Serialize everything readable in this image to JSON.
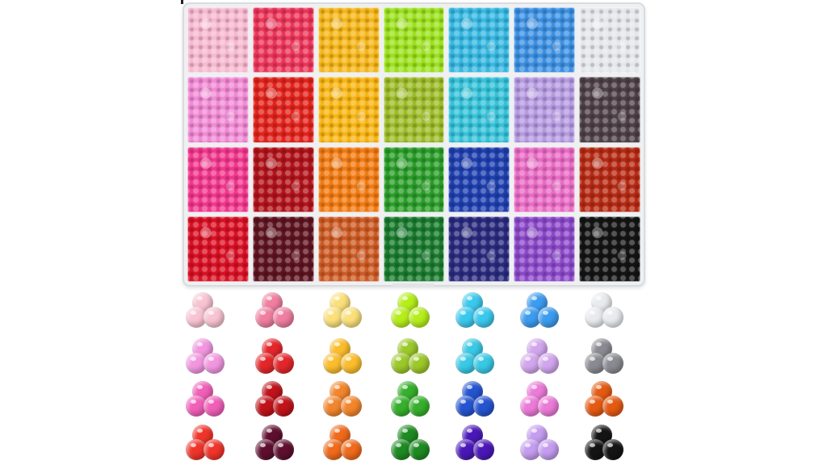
{
  "palette": [
    [
      "#f6b9cf",
      "#ea3558",
      "#f4b51a",
      "#9be01e",
      "#37b7e0",
      "#3c8fe0",
      "#e5e6ea"
    ],
    [
      "#f08ad4",
      "#e0231c",
      "#f7b414",
      "#9cbb2a",
      "#36c1d8",
      "#b59ae0",
      "#4e4047"
    ],
    [
      "#f0378c",
      "#b0131a",
      "#f07a12",
      "#2b9c2a",
      "#1f3fae",
      "#e86bc4",
      "#b52a14"
    ],
    [
      "#d81024",
      "#5e1420",
      "#cc5a24",
      "#1a7a2e",
      "#2a2a7e",
      "#8a48c8",
      "#141414"
    ]
  ],
  "swatches": [
    [
      "#f8c3d2",
      "#f07ea0",
      "#fbe07a",
      "#b5ee1a",
      "#3ac9ee",
      "#3b9cf0",
      "#e8eaee"
    ],
    [
      "#f296e0",
      "#e4262a",
      "#fbbd2c",
      "#9cc82a",
      "#38c9e6",
      "#d2a6ee",
      "#8a8a92"
    ],
    [
      "#f15fb8",
      "#c0131a",
      "#f3862c",
      "#36b02c",
      "#2454d0",
      "#ec7ad8",
      "#e55a12"
    ],
    [
      "#f0342a",
      "#5e0f2e",
      "#f06a1c",
      "#1d8a22",
      "#4a18b8",
      "#c49cf0",
      "#141414"
    ]
  ]
}
